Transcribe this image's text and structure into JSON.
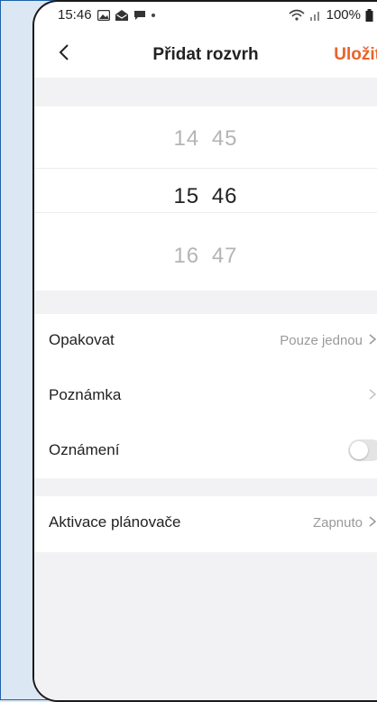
{
  "status": {
    "time": "15:46",
    "battery": "100%"
  },
  "header": {
    "title": "Přidat rozvrh",
    "save_label": "Uložit"
  },
  "picker": {
    "above": {
      "hour": "14",
      "minute": "45"
    },
    "selected": {
      "hour": "15",
      "minute": "46"
    },
    "below": {
      "hour": "16",
      "minute": "47"
    }
  },
  "settings": {
    "repeat": {
      "label": "Opakovat",
      "value": "Pouze jednou"
    },
    "note": {
      "label": "Poznámka"
    },
    "notification": {
      "label": "Oznámení",
      "enabled": false
    },
    "scheduler": {
      "label": "Aktivace plánovače",
      "value": "Zapnuto"
    }
  },
  "colors": {
    "accent": "#e8632b",
    "background": "#f2f2f4"
  }
}
